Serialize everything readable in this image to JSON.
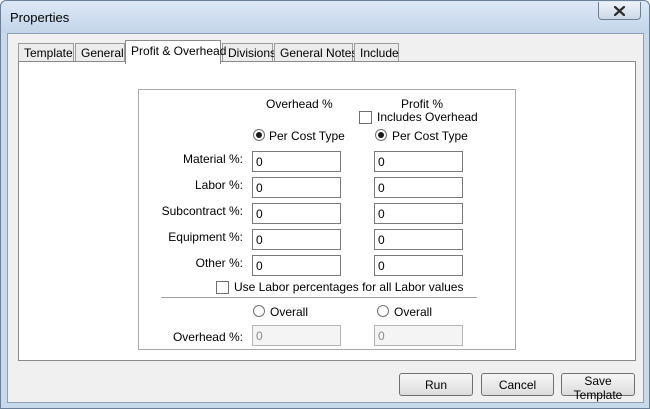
{
  "window": {
    "title": "Properties"
  },
  "tabs": [
    {
      "label": "Template"
    },
    {
      "label": "General"
    },
    {
      "label": "Profit & Overhead",
      "active": true
    },
    {
      "label": "Divisions"
    },
    {
      "label": "General Notes"
    },
    {
      "label": "Include"
    }
  ],
  "form": {
    "overhead_header": "Overhead %",
    "profit_header": "Profit %",
    "includes_overhead": {
      "label": "Includes Overhead",
      "checked": false
    },
    "overhead_per_cost_type": {
      "label": "Per Cost Type",
      "selected": true
    },
    "profit_per_cost_type": {
      "label": "Per Cost Type",
      "selected": true
    },
    "rows": [
      {
        "label": "Material %:",
        "overhead": "0",
        "profit": "0"
      },
      {
        "label": "Labor %:",
        "overhead": "0",
        "profit": "0"
      },
      {
        "label": "Subcontract %:",
        "overhead": "0",
        "profit": "0"
      },
      {
        "label": "Equipment %:",
        "overhead": "0",
        "profit": "0"
      },
      {
        "label": "Other %:",
        "overhead": "0",
        "profit": "0"
      }
    ],
    "use_labor_percentages": {
      "label": "Use Labor percentages for all Labor values",
      "checked": false
    },
    "overhead_overall": {
      "label": "Overall",
      "selected": false
    },
    "profit_overall": {
      "label": "Overall",
      "selected": false
    },
    "overall_row": {
      "label": "Overhead %:",
      "overhead": "0",
      "profit": "0",
      "disabled": true
    }
  },
  "buttons": {
    "run": "Run",
    "cancel": "Cancel",
    "save_template": "Save Template"
  }
}
